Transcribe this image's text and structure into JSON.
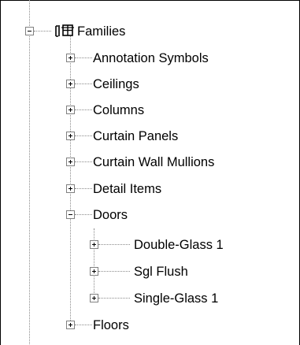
{
  "tree": {
    "root": {
      "label": "Families",
      "icon": "families-icon",
      "expanded": true
    },
    "children": [
      {
        "label": "Annotation Symbols",
        "expanded": false
      },
      {
        "label": "Ceilings",
        "expanded": false
      },
      {
        "label": "Columns",
        "expanded": false
      },
      {
        "label": "Curtain Panels",
        "expanded": false
      },
      {
        "label": "Curtain Wall Mullions",
        "expanded": false
      },
      {
        "label": "Detail Items",
        "expanded": false
      },
      {
        "label": "Doors",
        "expanded": true,
        "children": [
          {
            "label": "Double-Glass 1",
            "expanded": false
          },
          {
            "label": "Sgl Flush",
            "expanded": false
          },
          {
            "label": "Single-Glass 1",
            "expanded": false
          }
        ]
      },
      {
        "label": "Floors",
        "expanded": false
      }
    ]
  }
}
